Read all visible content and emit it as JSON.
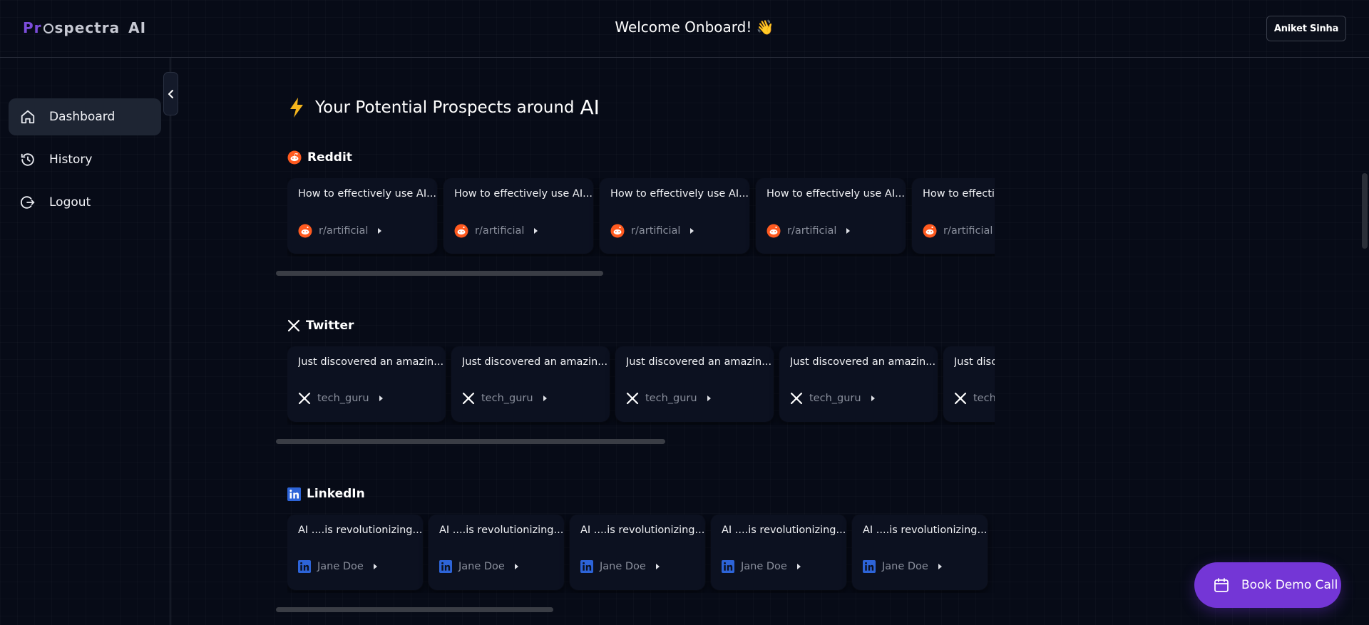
{
  "header": {
    "logo": {
      "part1": "Pr",
      "part2": "spectra",
      "part3": "AI"
    },
    "welcome": "Welcome Onboard! 👋",
    "user_name": "Aniket Sinha"
  },
  "sidebar": {
    "items": [
      {
        "label": "Dashboard",
        "icon": "home-icon",
        "active": true
      },
      {
        "label": "History",
        "icon": "history-icon",
        "active": false
      },
      {
        "label": "Logout",
        "icon": "logout-icon",
        "active": false
      }
    ]
  },
  "main": {
    "title": "Your Potential Prospects around",
    "title_accent": "AI",
    "sections": [
      {
        "name": "Reddit",
        "cards": [
          {
            "text": "How to effectively use AI...",
            "source": "r/artificial"
          },
          {
            "text": "How to effectively use AI...",
            "source": "r/artificial"
          },
          {
            "text": "How to effectively use AI...",
            "source": "r/artificial"
          },
          {
            "text": "How to effectively use AI...",
            "source": "r/artificial"
          },
          {
            "text": "How to effectively use AI...",
            "source": "r/artificial"
          }
        ]
      },
      {
        "name": "Twitter",
        "cards": [
          {
            "text": "Just discovered an amazin...",
            "source": "tech_guru"
          },
          {
            "text": "Just discovered an amazin...",
            "source": "tech_guru"
          },
          {
            "text": "Just discovered an amazin...",
            "source": "tech_guru"
          },
          {
            "text": "Just discovered an amazin...",
            "source": "tech_guru"
          },
          {
            "text": "Just discovered an amazin...",
            "source": "tech_guru"
          }
        ]
      },
      {
        "name": "LinkedIn",
        "cards": [
          {
            "text": "AI ....is revolutionizing...",
            "source": "Jane Doe"
          },
          {
            "text": "AI ....is revolutionizing...",
            "source": "Jane Doe"
          },
          {
            "text": "AI ....is revolutionizing...",
            "source": "Jane Doe"
          },
          {
            "text": "AI ....is revolutionizing...",
            "source": "Jane Doe"
          },
          {
            "text": "AI ....is revolutionizing...",
            "source": "Jane Doe"
          }
        ]
      }
    ]
  },
  "demo_button": {
    "label": "Book Demo Call"
  },
  "colors": {
    "accent": "#7436d6",
    "reddit": "#ff5a1f",
    "linkedin": "#2d64d8",
    "bolt": "#f5b51c"
  }
}
